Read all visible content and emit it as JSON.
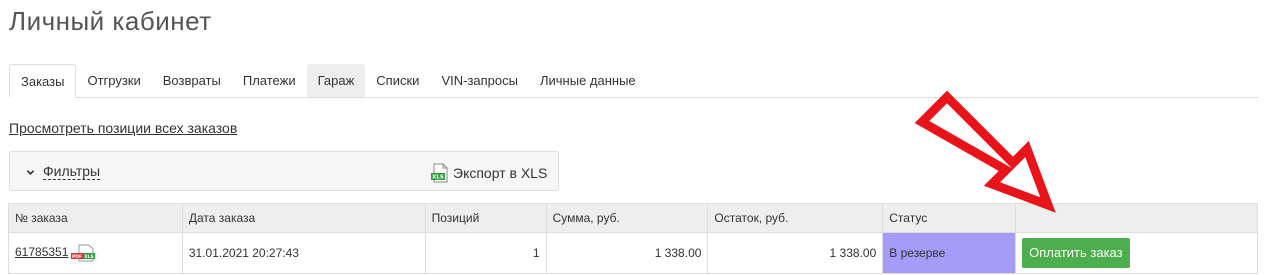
{
  "page": {
    "title": "Личный кабинет"
  },
  "tabs": [
    {
      "label": "Заказы",
      "state": "active"
    },
    {
      "label": "Отгрузки",
      "state": "normal"
    },
    {
      "label": "Возвраты",
      "state": "normal"
    },
    {
      "label": "Платежи",
      "state": "normal"
    },
    {
      "label": "Гараж",
      "state": "hover"
    },
    {
      "label": "Списки",
      "state": "normal"
    },
    {
      "label": "VIN-запросы",
      "state": "normal"
    },
    {
      "label": "Личные данные",
      "state": "normal"
    }
  ],
  "links": {
    "view_all_positions": "Просмотреть позиции всех заказов"
  },
  "filters": {
    "toggle_label": "Фильтры",
    "export_label": "Экспорт в XLS",
    "export_icon_text": "XLS"
  },
  "table": {
    "columns": [
      "№ заказа",
      "Дата заказа",
      "Позиций",
      "Сумма, руб.",
      "Остаток, руб.",
      "Статус",
      ""
    ],
    "rows": [
      {
        "order_number": "61785351",
        "date": "31.01.2021 20:27:43",
        "positions": "1",
        "sum": "1 338.00",
        "balance": "1 338.00",
        "status": "В резерве",
        "action": "Оплатить заказ",
        "doc_icon_pdf": "PDF",
        "doc_icon_xls": "XLS"
      }
    ]
  },
  "colors": {
    "status_reserved": "#a59cf7",
    "pay_button": "#4cae4c",
    "annotation_arrow": "#e8141a"
  },
  "icons": [
    "chevron-down-icon",
    "xls-file-icon",
    "pdf-xls-doc-icon",
    "red-arrow-annotation"
  ]
}
